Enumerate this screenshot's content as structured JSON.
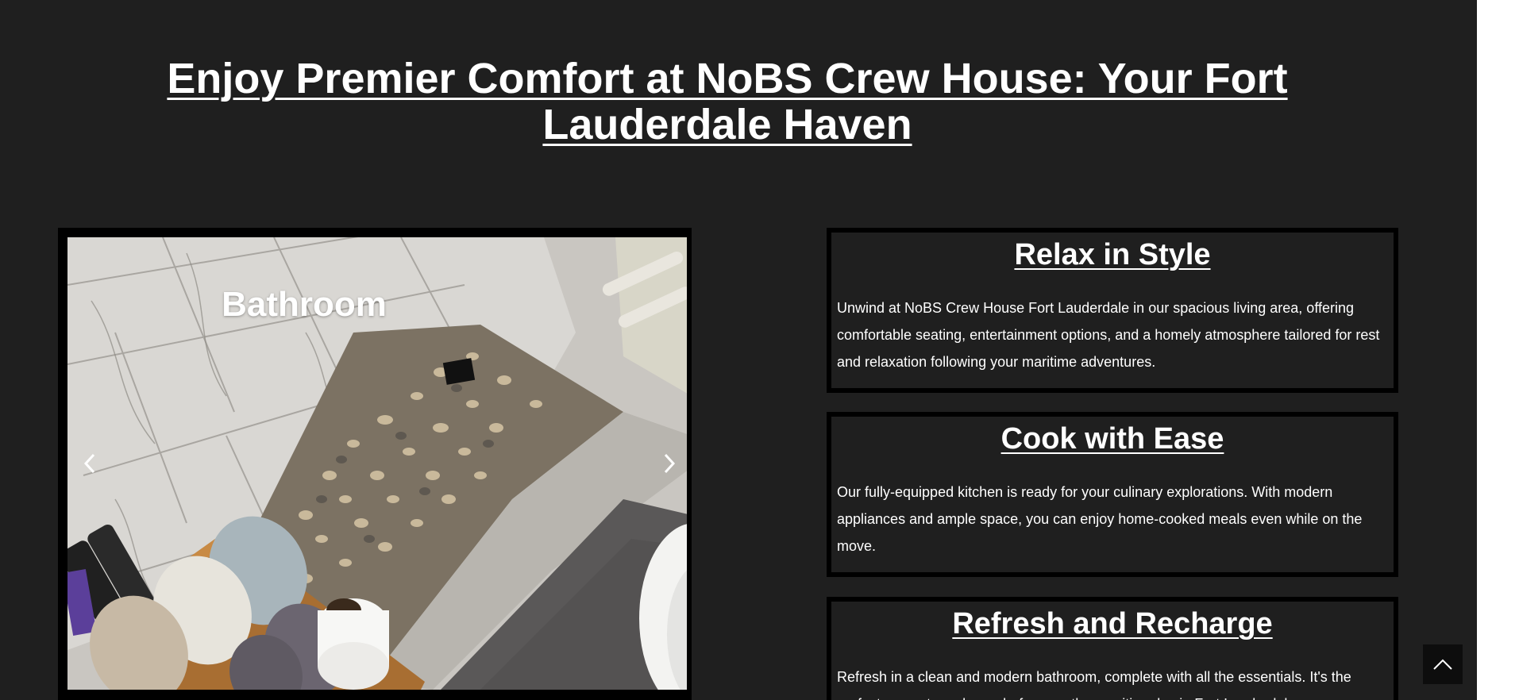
{
  "page": {
    "title": "Enjoy Premier Comfort at NoBS Crew House: Your Fort Lauderdale Haven"
  },
  "carousel": {
    "caption": "Bathroom",
    "prev_icon": "chevron-left-icon",
    "next_icon": "chevron-right-icon"
  },
  "features": [
    {
      "heading": "Relax in Style",
      "text": "Unwind at NoBS Crew House Fort Lauderdale in our spacious living area, offering comfortable seating, entertainment options, and a homely atmosphere tailored for rest and relaxation following your maritime adventures."
    },
    {
      "heading": "Cook with Ease",
      "text": "Our fully-equipped kitchen is ready for your culinary explorations. With modern appliances and ample space, you can enjoy home-cooked meals even while on the move."
    },
    {
      "heading": "Refresh and Recharge",
      "text": "Refresh in a clean and modern bathroom, complete with all the essentials. It's the perfect space to recharge before another exciting day in Fort Lauderdale."
    }
  ],
  "scroll_to_top": {
    "icon": "chevron-up-icon"
  },
  "colors": {
    "background": "#1f1f1f",
    "text": "#ffffff",
    "border": "#000000"
  }
}
